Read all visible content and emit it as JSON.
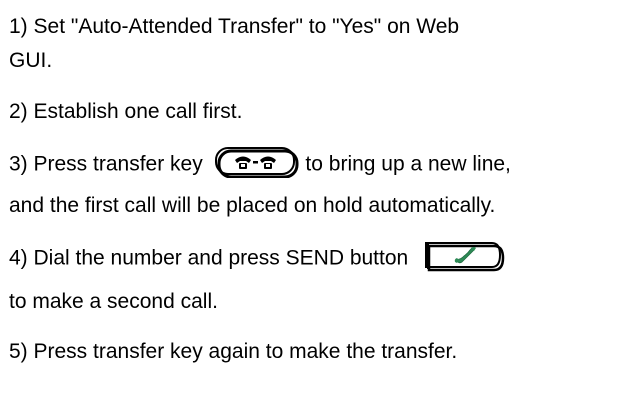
{
  "steps": [
    {
      "line1": "1) Set \"Auto-Attended Transfer\" to \"Yes\" on Web",
      "line2": "GUI."
    },
    {
      "text": "2) Establish one call first."
    },
    {
      "before": "3) Press transfer key",
      "after": "to bring up a new line,",
      "line2": "and the first call will be placed on hold automatically.",
      "icon": "transfer-key-icon"
    },
    {
      "before": "4) Dial the number and press SEND button",
      "line2": "to make a second call.",
      "icon": "send-key-icon"
    },
    {
      "text": "5) Press transfer key again to make the transfer."
    }
  ],
  "colors": {
    "text": "#000000",
    "send_handset": "#2e8b57"
  }
}
